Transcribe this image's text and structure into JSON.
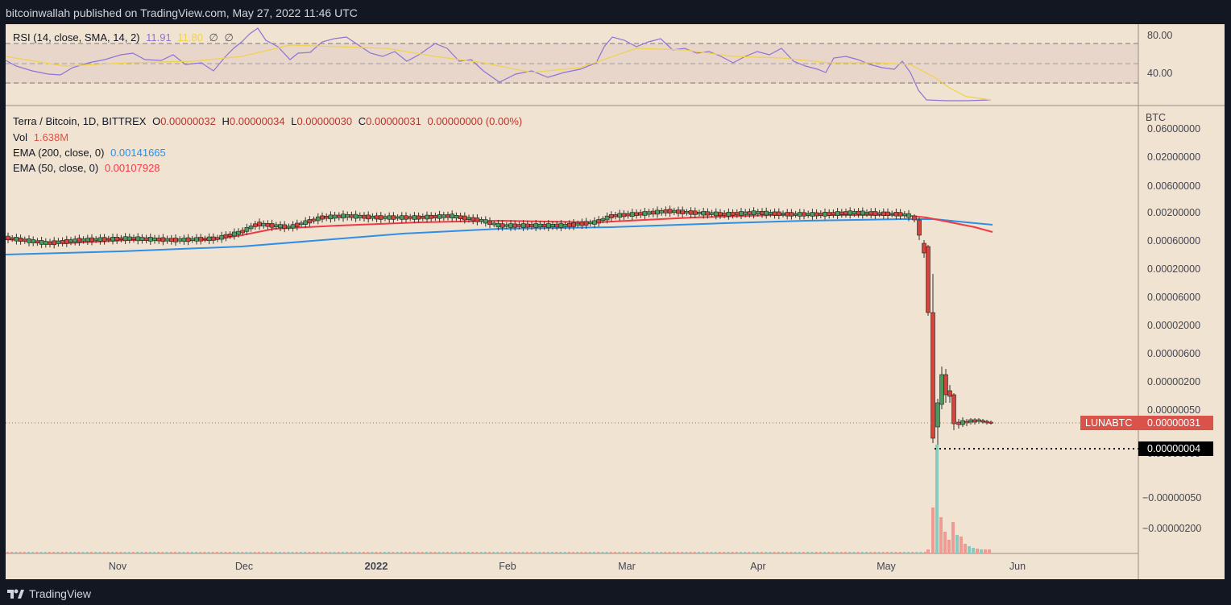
{
  "header": {
    "published_text": "bitcoinwallah published on TradingView.com, May 27, 2022 11:46 UTC"
  },
  "footer": {
    "brand": "TradingView"
  },
  "colors": {
    "background": "#f1e3d1",
    "ema200": "#2f8ee8",
    "ema50": "#ef3a46",
    "rsi": "#8e72d6",
    "rsi_sma": "#f4d03f",
    "candle_up": "#2f6f3f",
    "candle_down": "#b5372f",
    "price_tag": "#d9534a"
  },
  "rsi_panel": {
    "legend": {
      "name": "RSI (14, close, SMA, 14, 2)",
      "value1": "11.91",
      "value2": "11.80",
      "icon1": "∅",
      "icon2": "∅"
    },
    "y_ticks": [
      "80.00",
      "40.00"
    ]
  },
  "price_panel": {
    "legend": {
      "title": "Terra / Bitcoin, 1D, BITTREX",
      "o_label": "O",
      "o_value": "0.00000032",
      "h_label": "H",
      "h_value": "0.00000034",
      "l_label": "L",
      "l_value": "0.00000030",
      "c_label": "C",
      "c_value": "0.00000031",
      "change": "0.00000000 (0.00%)",
      "vol_label": "Vol",
      "vol_value": "1.638M",
      "ema200_label": "EMA (200, close, 0)",
      "ema200_value": "0.00141665",
      "ema50_label": "EMA (50, close, 0)",
      "ema50_value": "0.00107928"
    },
    "currency": "BTC",
    "price_tag": {
      "symbol": "LUNABTC",
      "value": "0.00000031"
    },
    "low_tag": "0.00000004"
  },
  "chart_data": {
    "type": "line",
    "title": "Terra / Bitcoin, 1D, BITTREX",
    "x_ticks": [
      "Nov",
      "Dec",
      "2022",
      "Feb",
      "Mar",
      "Apr",
      "May",
      "Jun"
    ],
    "y_ticks": [
      "0.06000000",
      "0.02000000",
      "0.00600000",
      "0.00200000",
      "0.00060000",
      "0.00020000",
      "0.00006000",
      "0.00002000",
      "0.00000600",
      "0.00000200",
      "0.00000050",
      "0.00000000",
      "−0.00000050",
      "−0.00000200"
    ],
    "series": [
      {
        "name": "EMA (200, close, 0)",
        "x": [
          "2021-10-01",
          "2021-11-01",
          "2021-12-01",
          "2022-01-01",
          "2022-02-01",
          "2022-03-01",
          "2022-04-01",
          "2022-05-01",
          "2022-05-10",
          "2022-05-27"
        ],
        "values": [
          0.00055,
          0.00064,
          0.00075,
          0.00098,
          0.00118,
          0.00128,
          0.00142,
          0.00152,
          0.00155,
          0.00141665
        ]
      },
      {
        "name": "EMA (50, close, 0)",
        "x": [
          "2021-10-01",
          "2021-11-01",
          "2021-12-01",
          "2022-01-01",
          "2022-02-01",
          "2022-03-01",
          "2022-04-01",
          "2022-05-01",
          "2022-05-10",
          "2022-05-27"
        ],
        "values": [
          0.0008,
          0.00075,
          0.00078,
          0.0015,
          0.0018,
          0.0017,
          0.0021,
          0.0022,
          0.0021,
          0.00107928
        ]
      },
      {
        "name": "LUNABTC close",
        "x": [
          "2021-10-01",
          "2021-11-01",
          "2021-12-01",
          "2022-01-01",
          "2022-02-01",
          "2022-03-01",
          "2022-04-01",
          "2022-05-01",
          "2022-05-08",
          "2022-05-09",
          "2022-05-10",
          "2022-05-11",
          "2022-05-12",
          "2022-05-13",
          "2022-05-14",
          "2022-05-16",
          "2022-05-20",
          "2022-05-27"
        ],
        "values": [
          0.0008,
          0.00077,
          0.0008,
          0.0017,
          0.0017,
          0.0024,
          0.0025,
          0.0023,
          0.00115,
          0.0004,
          7e-05,
          4e-06,
          4e-08,
          3e-07,
          8e-07,
          5e-07,
          3.2e-07,
          3.1e-07
        ]
      }
    ],
    "rsi": {
      "name": "RSI (14, close, SMA, 14, 2)",
      "last": 11.91,
      "sma_last": 11.8,
      "ylim": [
        0,
        100
      ],
      "bands": [
        70,
        50,
        30
      ]
    },
    "volume": {
      "name": "Vol",
      "last": "1.638M"
    },
    "last_price": 3.1e-07,
    "lowest_price": 4e-08
  }
}
